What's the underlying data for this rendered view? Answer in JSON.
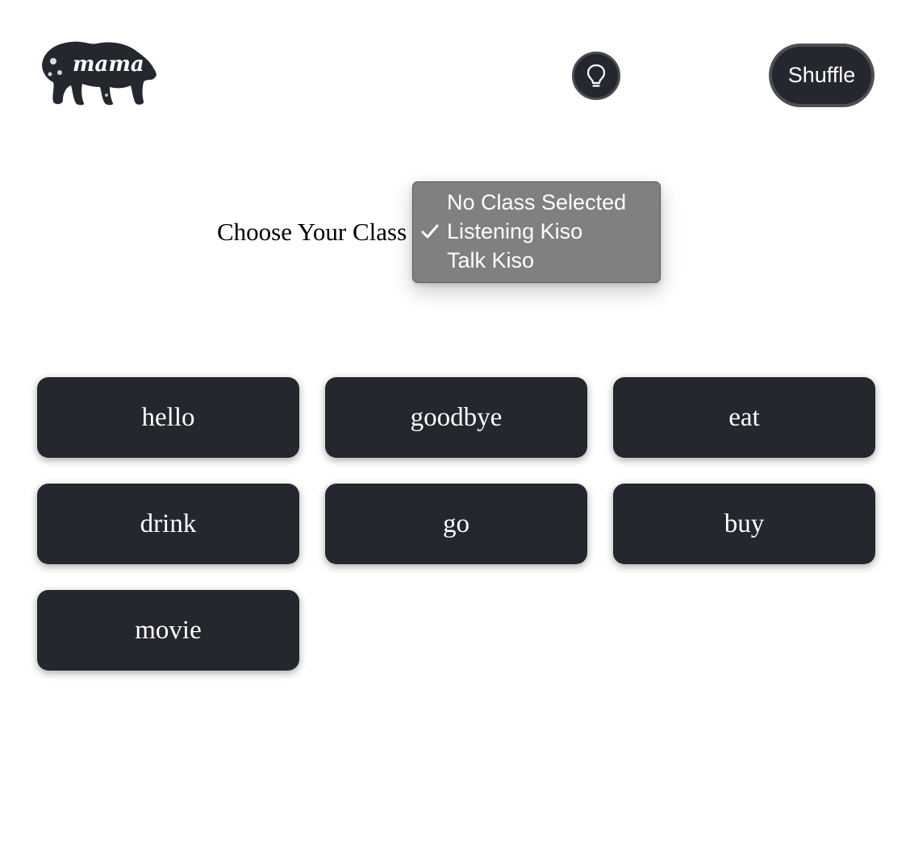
{
  "header": {
    "logo": {
      "icon": "mama-bear-logo",
      "text": "mama"
    },
    "hint_button": {
      "icon": "lightbulb-icon"
    },
    "shuffle_label": "Shuffle"
  },
  "class_select": {
    "label": "Choose Your Class",
    "selected": "Listening Kiso",
    "options": [
      {
        "label": "No Class Selected",
        "checked": false
      },
      {
        "label": "Listening Kiso",
        "checked": true
      },
      {
        "label": "Talk Kiso",
        "checked": false
      }
    ]
  },
  "cards": [
    "hello",
    "goodbye",
    "eat",
    "drink",
    "go",
    "buy",
    "movie"
  ],
  "colors": {
    "card_bg": "#25272e",
    "card_text": "#ffffff",
    "dropdown_bg": "#808080",
    "page_bg": "#ffffff"
  }
}
